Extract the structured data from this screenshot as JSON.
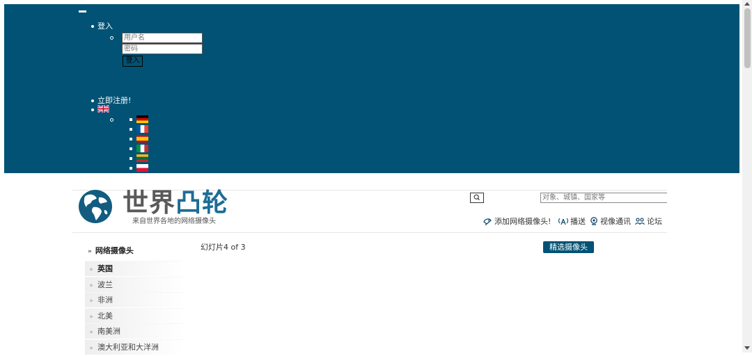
{
  "top_menu": {
    "login_label": "登入",
    "username_placeholder": "用户名",
    "password_placeholder": "密码",
    "login_button": "登入",
    "register_label": "立即注册!",
    "languages": [
      "英语",
      "德语",
      "法语",
      "西班牙语",
      "意大利语",
      "立陶宛语",
      "波兰语"
    ]
  },
  "header": {
    "logo_word_1": "世界",
    "logo_word_2": "凸轮",
    "logo_subtitle": "来自世界各地的网络摄像头",
    "search_placeholder": "对象、城镇、国家等",
    "nav": [
      {
        "label": "添加网络摄像头!",
        "icon": "satellite-dish-icon"
      },
      {
        "label": "播送",
        "icon": "broadcast-icon"
      },
      {
        "label": "视像通讯",
        "icon": "webcam-icon"
      },
      {
        "label": "论坛",
        "icon": "users-icon"
      }
    ]
  },
  "sidebar": {
    "title": "网络摄像头",
    "items": [
      {
        "label": "英国"
      },
      {
        "label": "波兰"
      },
      {
        "label": "非洲"
      },
      {
        "label": "北美"
      },
      {
        "label": "南美洲"
      },
      {
        "label": "澳大利亚和大洋洲"
      }
    ]
  },
  "main": {
    "slide_counter": "幻灯片4 of 3",
    "featured_button": "精选摄像头"
  },
  "colors": {
    "navy": "#015274",
    "logo_blue": "#1c6d96",
    "logo_gray": "#5a5a5a"
  }
}
